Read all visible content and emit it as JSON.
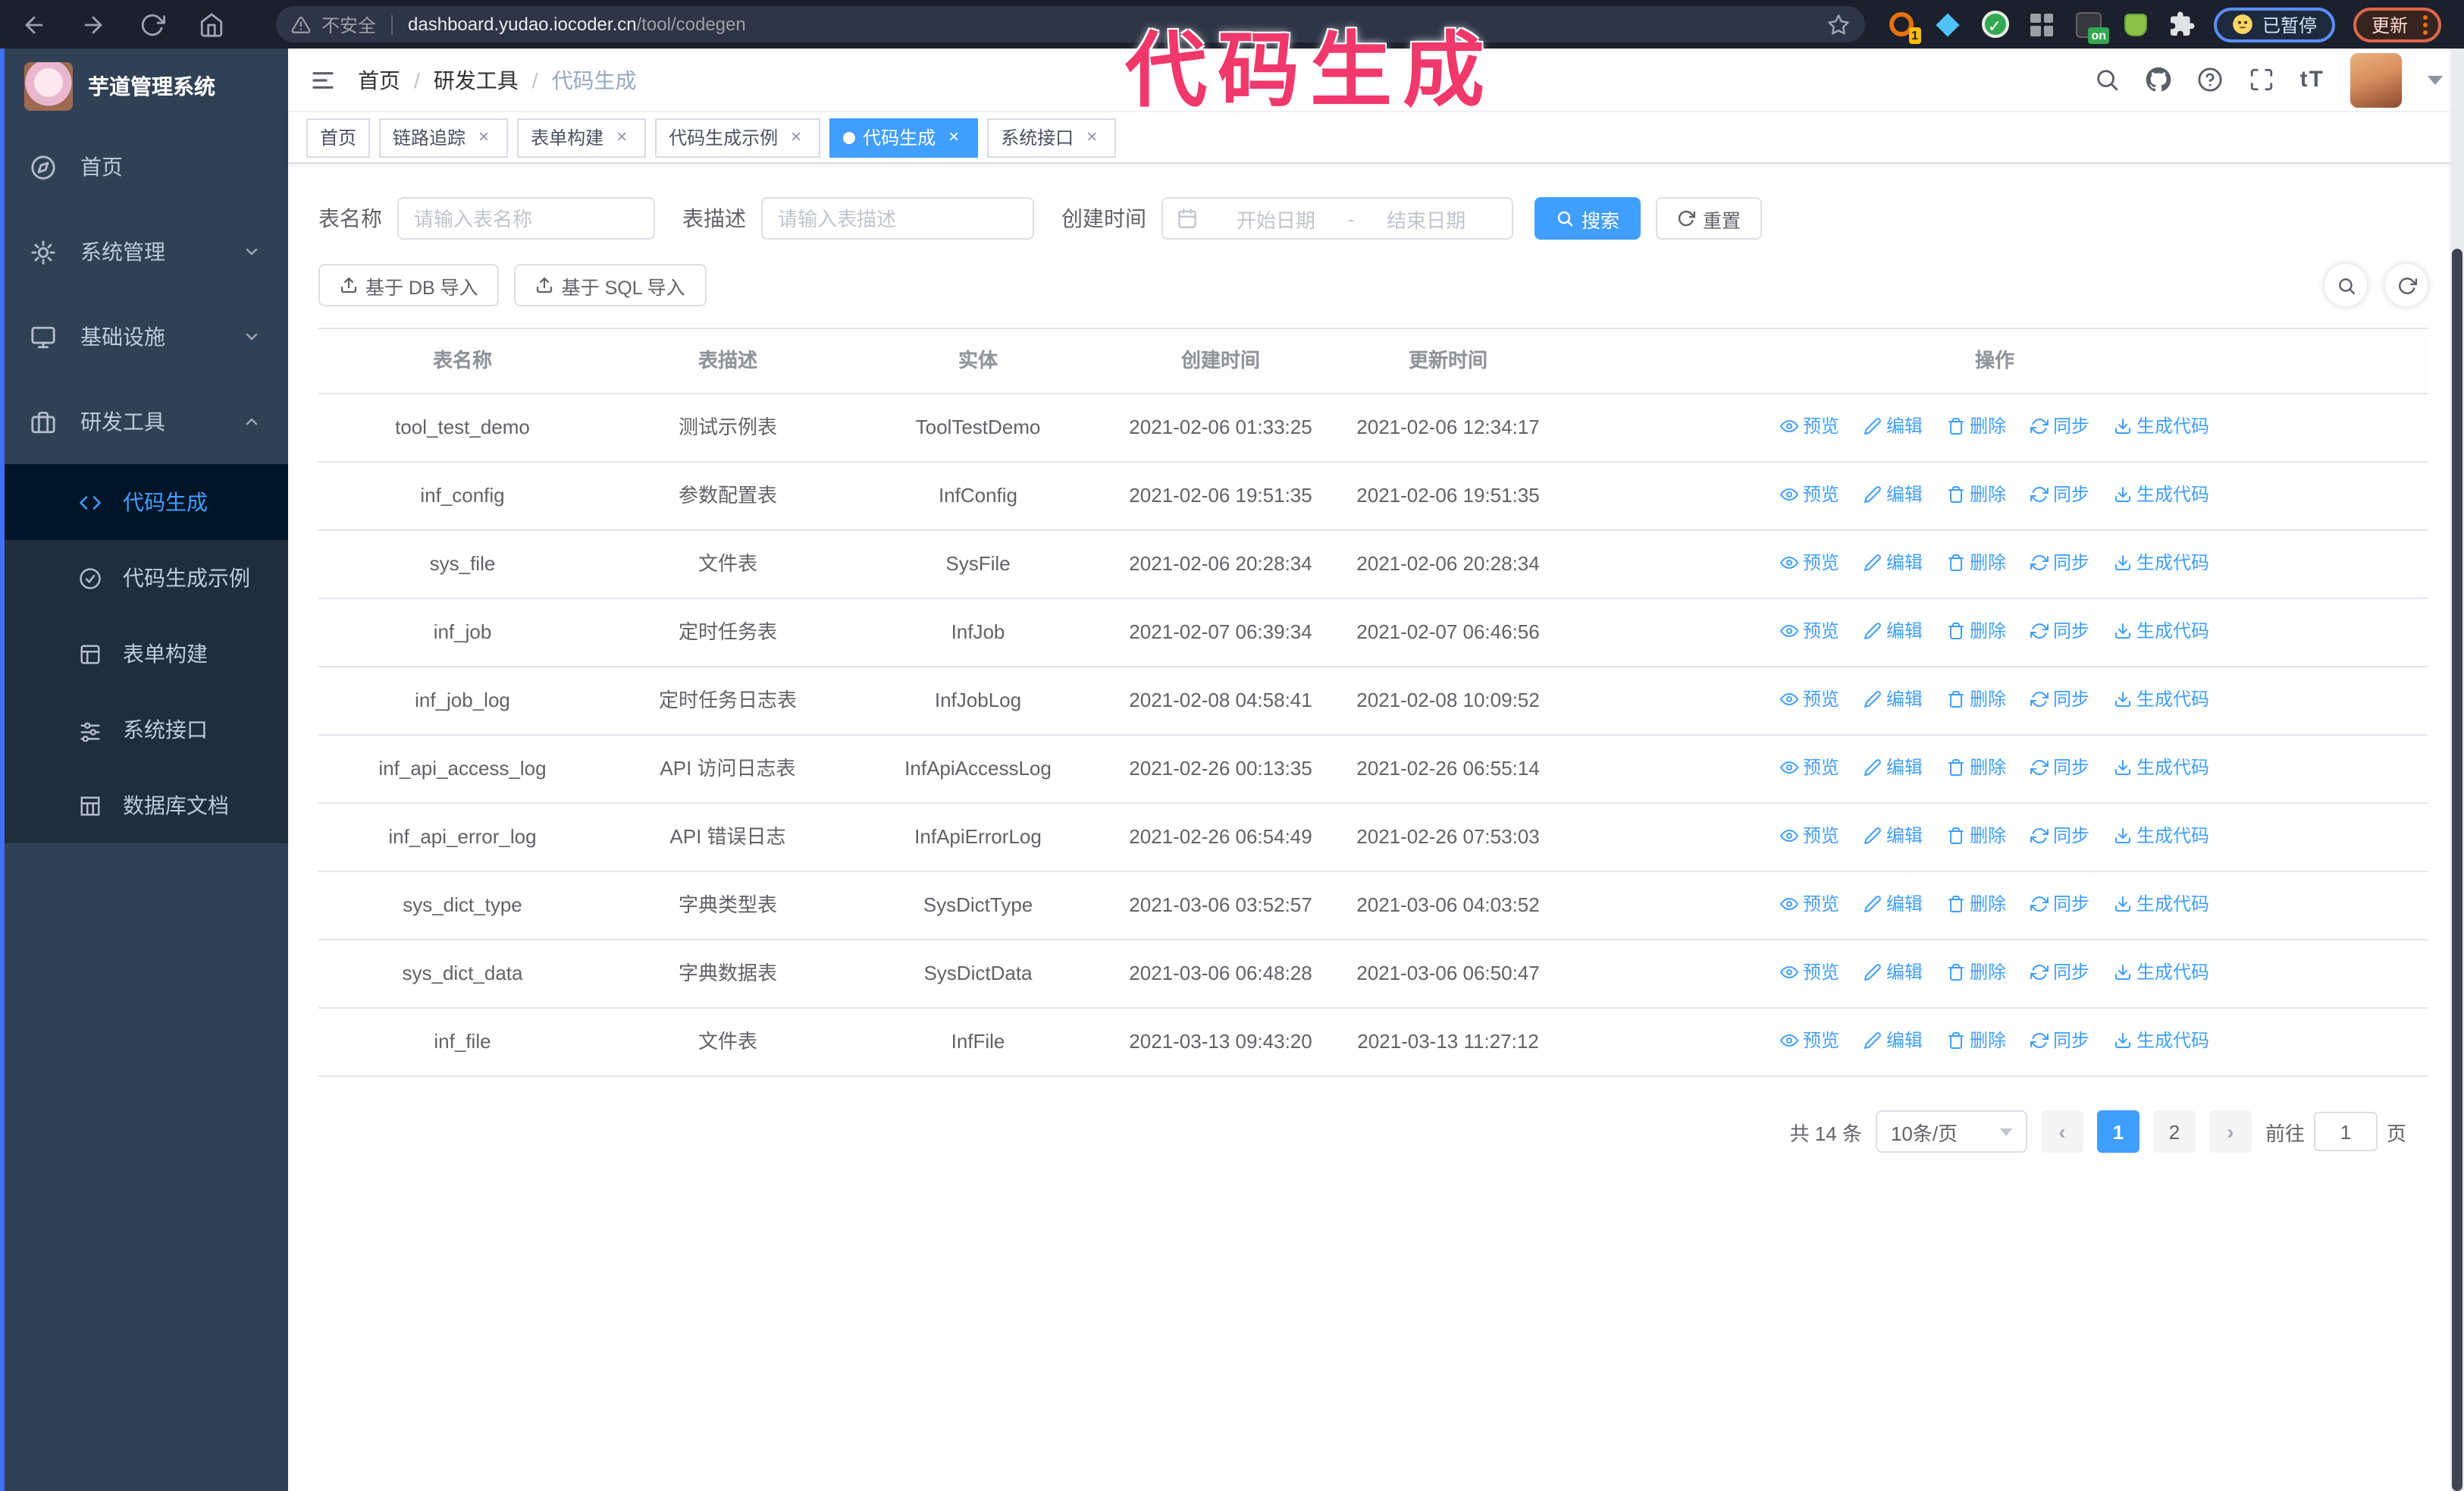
{
  "browser": {
    "security_label": "不安全",
    "url_domain": "dashboard.yudao.iocoder.cn",
    "url_path": "/tool/codegen",
    "ext_badge": "1",
    "ext_on": "on",
    "paused_label": "已暂停",
    "update_label": "更新"
  },
  "overlay": {
    "text": "代码生成",
    "color": "#f0386b"
  },
  "sidebar": {
    "title": "芋道管理系统",
    "items": [
      {
        "label": "首页",
        "icon": "dashboard-icon"
      },
      {
        "label": "系统管理",
        "icon": "gear-icon",
        "chevron": "down"
      },
      {
        "label": "基础设施",
        "icon": "monitor-icon",
        "chevron": "down"
      },
      {
        "label": "研发工具",
        "icon": "tools-icon",
        "chevron": "up",
        "expanded": true
      }
    ],
    "subitems": [
      {
        "label": "代码生成",
        "icon": "code-icon",
        "active": true
      },
      {
        "label": "代码生成示例",
        "icon": "badge-check-icon"
      },
      {
        "label": "表单构建",
        "icon": "form-icon"
      },
      {
        "label": "系统接口",
        "icon": "sliders-icon"
      },
      {
        "label": "数据库文档",
        "icon": "db-doc-icon"
      }
    ]
  },
  "header": {
    "breadcrumb": [
      "首页",
      "研发工具",
      "代码生成"
    ],
    "font_size_label": "tT"
  },
  "tabs": [
    {
      "label": "首页",
      "closable": false,
      "active": false
    },
    {
      "label": "链路追踪",
      "closable": true,
      "active": false
    },
    {
      "label": "表单构建",
      "closable": true,
      "active": false
    },
    {
      "label": "代码生成示例",
      "closable": true,
      "active": false
    },
    {
      "label": "代码生成",
      "closable": true,
      "active": true
    },
    {
      "label": "系统接口",
      "closable": true,
      "active": false
    }
  ],
  "filters": {
    "table_name_label": "表名称",
    "table_name_placeholder": "请输入表名称",
    "table_desc_label": "表描述",
    "table_desc_placeholder": "请输入表描述",
    "create_time_label": "创建时间",
    "start_placeholder": "开始日期",
    "range_separator": "-",
    "end_placeholder": "结束日期",
    "search_label": "搜索",
    "reset_label": "重置"
  },
  "toolbar": {
    "import_db_label": "基于 DB 导入",
    "import_sql_label": "基于 SQL 导入"
  },
  "table": {
    "columns": [
      "表名称",
      "表描述",
      "实体",
      "创建时间",
      "更新时间",
      "操作"
    ],
    "actions": [
      {
        "name": "preview",
        "icon": "eye-icon",
        "label": "预览"
      },
      {
        "name": "edit",
        "icon": "edit-icon",
        "label": "编辑"
      },
      {
        "name": "delete",
        "icon": "trash-icon",
        "label": "删除"
      },
      {
        "name": "sync",
        "icon": "sync-icon",
        "label": "同步"
      },
      {
        "name": "generate",
        "icon": "download-icon",
        "label": "生成代码"
      }
    ],
    "rows": [
      {
        "name": "tool_test_demo",
        "desc": "测试示例表",
        "entity": "ToolTestDemo",
        "created": "2021-02-06 01:33:25",
        "updated": "2021-02-06 12:34:17"
      },
      {
        "name": "inf_config",
        "desc": "参数配置表",
        "entity": "InfConfig",
        "created": "2021-02-06 19:51:35",
        "updated": "2021-02-06 19:51:35"
      },
      {
        "name": "sys_file",
        "desc": "文件表",
        "entity": "SysFile",
        "created": "2021-02-06 20:28:34",
        "updated": "2021-02-06 20:28:34"
      },
      {
        "name": "inf_job",
        "desc": "定时任务表",
        "entity": "InfJob",
        "created": "2021-02-07 06:39:34",
        "updated": "2021-02-07 06:46:56"
      },
      {
        "name": "inf_job_log",
        "desc": "定时任务日志表",
        "entity": "InfJobLog",
        "created": "2021-02-08 04:58:41",
        "updated": "2021-02-08 10:09:52"
      },
      {
        "name": "inf_api_access_log",
        "desc": "API 访问日志表",
        "entity": "InfApiAccessLog",
        "created": "2021-02-26 00:13:35",
        "updated": "2021-02-26 06:55:14"
      },
      {
        "name": "inf_api_error_log",
        "desc": "API 错误日志",
        "entity": "InfApiErrorLog",
        "created": "2021-02-26 06:54:49",
        "updated": "2021-02-26 07:53:03"
      },
      {
        "name": "sys_dict_type",
        "desc": "字典类型表",
        "entity": "SysDictType",
        "created": "2021-03-06 03:52:57",
        "updated": "2021-03-06 04:03:52"
      },
      {
        "name": "sys_dict_data",
        "desc": "字典数据表",
        "entity": "SysDictData",
        "created": "2021-03-06 06:48:28",
        "updated": "2021-03-06 06:50:47"
      },
      {
        "name": "inf_file",
        "desc": "文件表",
        "entity": "InfFile",
        "created": "2021-03-13 09:43:20",
        "updated": "2021-03-13 11:27:12"
      }
    ]
  },
  "pagination": {
    "total_label": "共 14 条",
    "page_size": "10条/页",
    "pages": [
      "1",
      "2"
    ],
    "active_page": "1",
    "goto_label": "前往",
    "goto_value": "1",
    "page_suffix": "页"
  },
  "colors": {
    "accent": "#409eff",
    "chrome_bg": "#1b202c",
    "sidebar_bg": "#304156",
    "submenu_bg": "#1f2d3d",
    "overlay_pink": "#f0386b",
    "table_border": "#dfe6ec"
  }
}
